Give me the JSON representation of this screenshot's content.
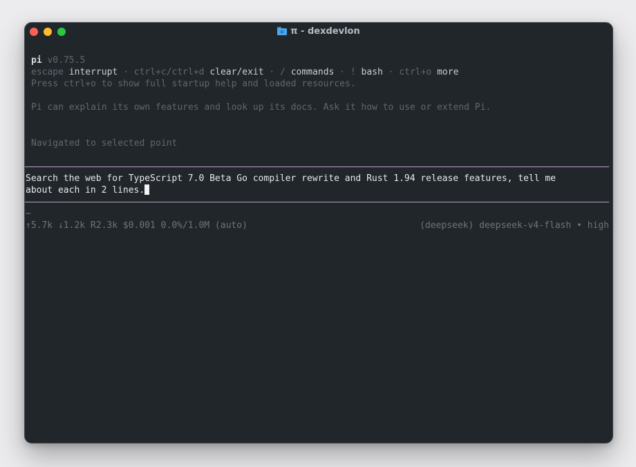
{
  "window": {
    "title": "π - dexdevlon",
    "title_icon": "folder-icon"
  },
  "header": {
    "app_name": "pi",
    "version": "v0.75.5",
    "shortcuts": [
      {
        "key": "escape",
        "action": "interrupt"
      },
      {
        "key": "ctrl+c/ctrl+d",
        "action": "clear/exit"
      },
      {
        "key": "/",
        "action": "commands"
      },
      {
        "key": "!",
        "action": "bash"
      },
      {
        "key": "ctrl+o",
        "action": "more"
      }
    ],
    "separator": "·",
    "help_hint": "Press ctrl+o to show full startup help and loaded resources.",
    "info": "Pi can explain its own features and look up its docs. Ask it how to use or extend Pi."
  },
  "messages": {
    "navigation": "Navigated to selected point"
  },
  "prompt": {
    "line1": "Search the web for TypeScript 7.0 Beta Go compiler rewrite and Rust 1.94 release features, tell me",
    "line2": "about each in 2 lines."
  },
  "status": {
    "cwd": "~",
    "tokens": "↑5.7k ↓1.2k R2.3k $0.001 0.0%/1.0M (auto)",
    "model": "(deepseek) deepseek-v4-flash • high"
  },
  "colors": {
    "background": "#21262b",
    "rule": "#b8a3c2",
    "dim_text": "#5f6770",
    "bright_text": "#c9ced3"
  }
}
